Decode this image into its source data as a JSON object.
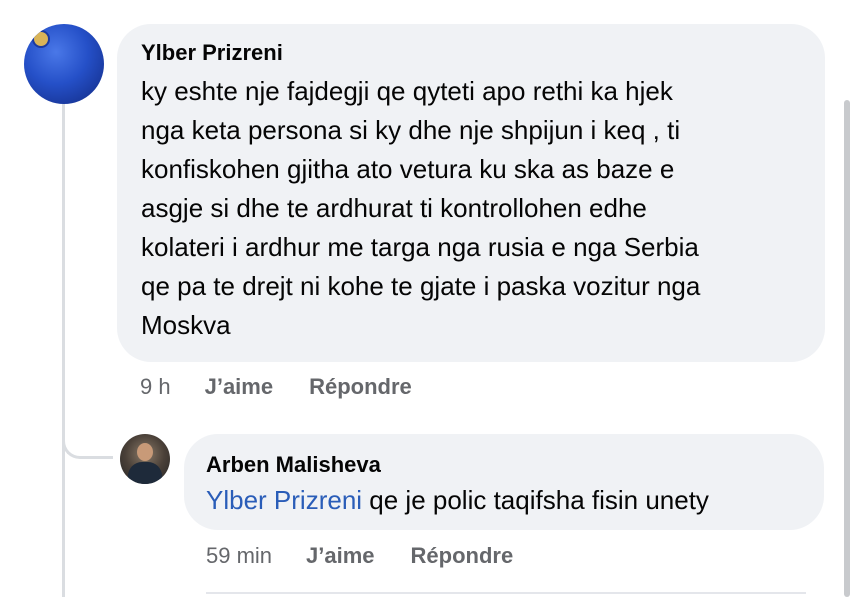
{
  "comments": [
    {
      "author": "Ylber Prizreni",
      "text": "ky eshte nje fajdegji qe qyteti apo rethi ka hjek\nnga keta persona si ky dhe nje shpijun i keq , ti\nkonfiskohen gjitha ato vetura ku ska as baze e\nasgje si dhe te ardhurat ti kontrollohen edhe\nkolateri i ardhur me targa nga rusia e nga Serbia\nqe pa te drejt ni kohe te gjate i paska vozitur nga\nMoskva",
      "time": "9 h",
      "like_label": "J’aime",
      "reply_label": "Répondre"
    }
  ],
  "reply": {
    "author": "Arben Malisheva",
    "mention": "Ylber Prizreni",
    "text": " qe je polic taqifsha fisin unety",
    "time": "59 min",
    "like_label": "J’aime",
    "reply_label": "Répondre"
  },
  "colors": {
    "bubble": "#f0f2f5",
    "text": "#050505",
    "meta": "#65676b",
    "mention": "#2a5db8",
    "thread_line": "#dadde1"
  },
  "icons": {
    "avatar_1": "profile-photo-blue",
    "avatar_2": "profile-photo-person"
  }
}
